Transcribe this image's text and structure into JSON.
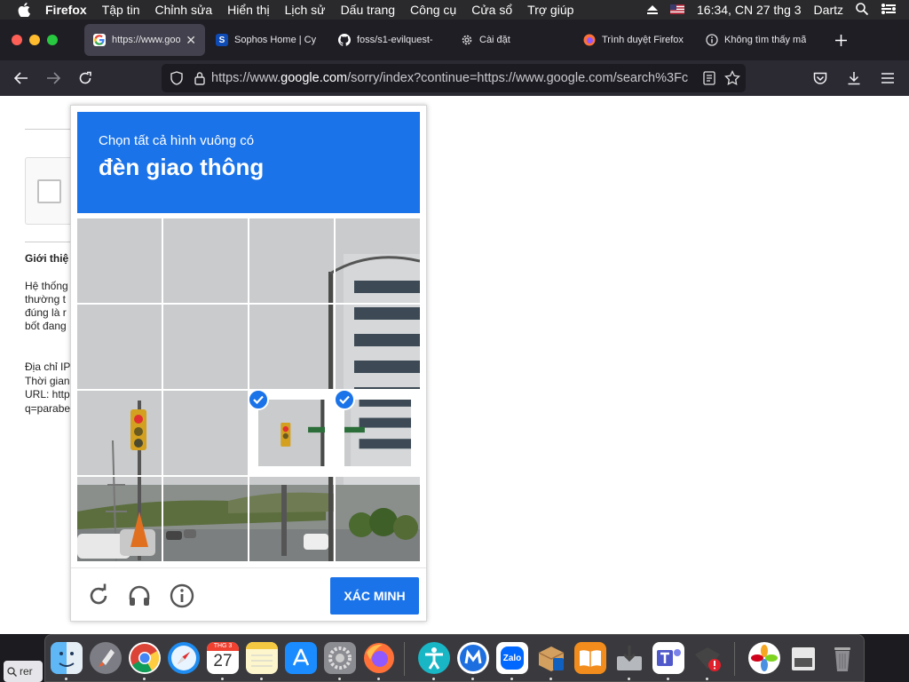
{
  "menubar": {
    "app_name": "Firefox",
    "items": [
      "Tập tin",
      "Chỉnh sửa",
      "Hiển thị",
      "Lịch sử",
      "Dấu trang",
      "Công cụ",
      "Cửa sổ",
      "Trợ giúp"
    ],
    "clock": "16:34, CN 27 thg 3",
    "user": "Dartz"
  },
  "tabs": [
    {
      "title": "https://www.goo",
      "icon": "google-icon",
      "active": true
    },
    {
      "title": "Sophos Home | Cy",
      "icon": "sophos-icon",
      "active": false
    },
    {
      "title": "foss/s1-evilquest-",
      "icon": "github-icon",
      "active": false
    },
    {
      "title": "Cài đặt",
      "icon": "gear-icon",
      "active": false
    },
    {
      "title": "Trình duyệt Firefox",
      "icon": "firefox-icon",
      "active": false
    },
    {
      "title": "Không tìm thấy mã",
      "icon": "info-icon",
      "active": false
    }
  ],
  "url": {
    "prefix": "https://www.",
    "domain": "google.com",
    "rest": "/sorry/index?continue=https://www.google.com/search%3Fc"
  },
  "page": {
    "heading": "Giới thiệ",
    "para": [
      "Hệ thống",
      "thường t",
      "đúng là r",
      "bốt đang"
    ],
    "ip_lines": [
      "Địa chỉ IP",
      "Thời gian",
      "URL: http",
      "q=parabe"
    ]
  },
  "captcha": {
    "instruction": "Chọn tất cả hình vuông có",
    "object": "đèn giao thông",
    "selected_tiles": [
      10,
      11
    ],
    "verify_label": "XÁC MINH"
  },
  "dock": {
    "calendar_month": "THG 3",
    "calendar_day": "27",
    "zalo_label": "Zalo"
  },
  "spotlight_text": "rer",
  "colors": {
    "captcha_blue": "#1a73e8",
    "menubar": "#2a2a2c",
    "tabbar": "#1f1e25",
    "navbar": "#2b2a33"
  }
}
